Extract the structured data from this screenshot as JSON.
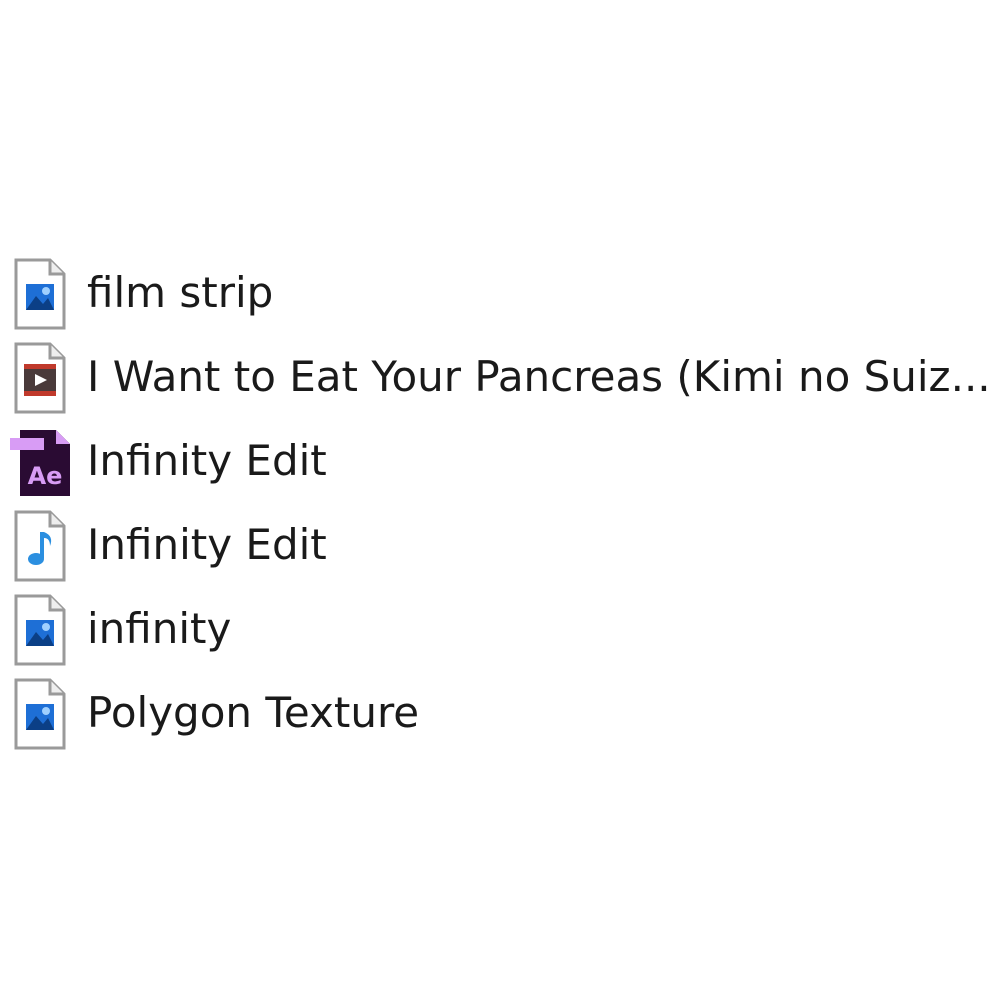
{
  "files": [
    {
      "name": "film strip",
      "icon": "image-file-icon"
    },
    {
      "name": "I Want to Eat Your Pancreas (Kimi no Suiz...",
      "icon": "video-file-icon"
    },
    {
      "name": "Infinity Edit",
      "icon": "after-effects-file-icon",
      "icon_label": "Ae"
    },
    {
      "name": "Infinity Edit",
      "icon": "audio-file-icon"
    },
    {
      "name": "infinity",
      "icon": "image-file-icon"
    },
    {
      "name": "Polygon Texture",
      "icon": "image-file-icon"
    }
  ],
  "colors": {
    "image_blue": "#1e6fd6",
    "audio_blue": "#2b8fe0",
    "video_red": "#c0392b",
    "ae_dark": "#2a0b33",
    "ae_purple": "#d89cf5",
    "page_outline": "#9a9a9a"
  }
}
